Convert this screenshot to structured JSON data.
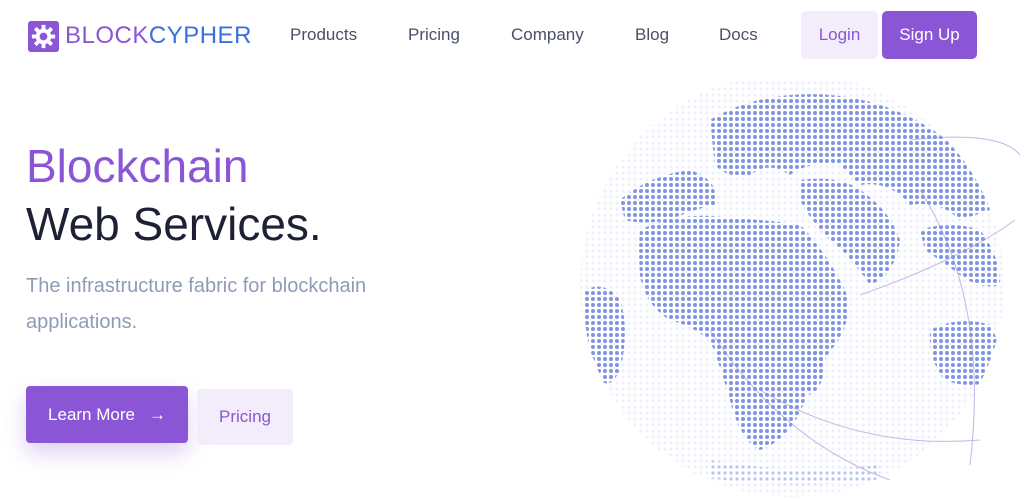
{
  "brand": {
    "part1": "BLOCK",
    "part2": "CYPHER"
  },
  "nav": {
    "products": "Products",
    "pricing": "Pricing",
    "company": "Company",
    "blog": "Blog",
    "docs": "Docs"
  },
  "auth": {
    "login": "Login",
    "signup": "Sign Up"
  },
  "hero": {
    "title_line1": "Blockchain",
    "title_line2": "Web Services.",
    "subtitle": "The infrastructure fabric for blockchain applications."
  },
  "cta": {
    "learn_more": "Learn More",
    "arrow": "→",
    "pricing": "Pricing"
  },
  "colors": {
    "accent": "#8b56d6",
    "brand_blue": "#3b6fe0",
    "globe_dots": "#7f95e3",
    "heading": "#1e2134",
    "muted": "#8f9bb6"
  },
  "icons": {
    "logo": "gear-cube-icon",
    "learn_more": "arrow-right-icon",
    "hero_graphic": "dotted-globe-illustration"
  }
}
